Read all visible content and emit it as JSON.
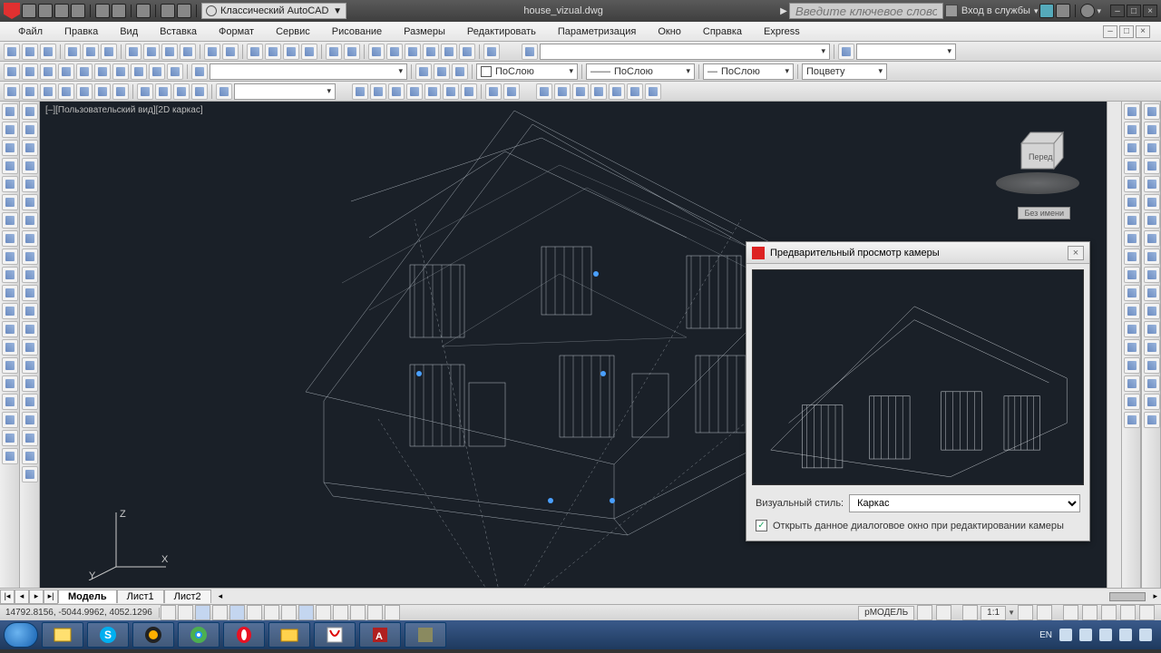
{
  "title": {
    "workspace_label": "Классический AutoCAD",
    "filename": "house_vizual.dwg",
    "search_placeholder": "Введите ключевое слово/фразу",
    "signin_label": "Вход в службы"
  },
  "menu": {
    "items": [
      "Файл",
      "Правка",
      "Вид",
      "Вставка",
      "Формат",
      "Сервис",
      "Рисование",
      "Размеры",
      "Редактировать",
      "Параметризация",
      "Окно",
      "Справка",
      "Express"
    ]
  },
  "props": {
    "color_label": "ПоСлою",
    "ltype_label": "ПоСлою",
    "lweight_label": "ПоСлою",
    "plot_label": "Поцвету"
  },
  "viewport": {
    "label": "[–][Пользовательский вид][2D каркас]",
    "cube_face": "Перед",
    "cube_btn": "Без имени",
    "axes": {
      "x": "X",
      "y": "Y",
      "z": "Z"
    }
  },
  "dialog": {
    "title": "Предварительный просмотр камеры",
    "style_label": "Визуальный стиль:",
    "style_value": "Каркас",
    "checkbox_label": "Открыть данное диалоговое окно при редактировании камеры",
    "checkbox_checked": true
  },
  "tabs": {
    "model": "Модель",
    "sheet1": "Лист1",
    "sheet2": "Лист2"
  },
  "status": {
    "coords": "14792.8156, -5044.9962, 4052.1296",
    "space_label": "рМОДЕЛЬ",
    "scale": "1:1"
  },
  "taskbar": {
    "lang": "EN",
    "time": ""
  }
}
